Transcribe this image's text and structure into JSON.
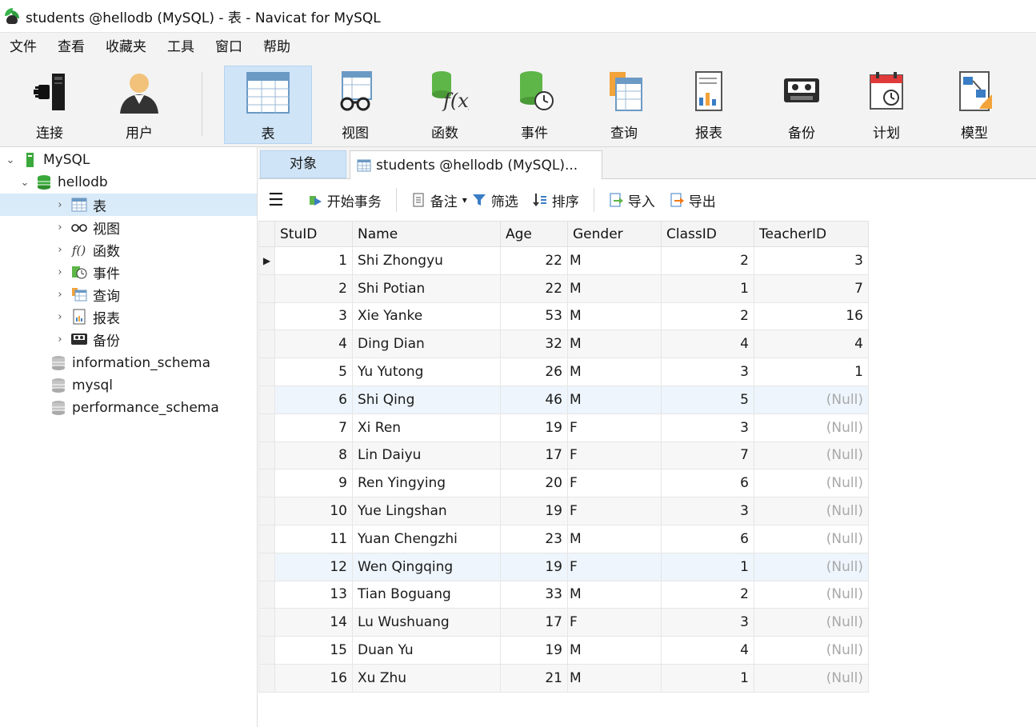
{
  "window": {
    "title": "students @hellodb (MySQL) - 表 - Navicat for MySQL"
  },
  "menu": [
    "文件",
    "查看",
    "收藏夹",
    "工具",
    "窗口",
    "帮助"
  ],
  "toolbar": {
    "connect": "连接",
    "user": "用户",
    "table": "表",
    "view": "视图",
    "function": "函数",
    "event": "事件",
    "query": "查询",
    "report": "报表",
    "backup": "备份",
    "schedule": "计划",
    "model": "模型"
  },
  "tree": {
    "server": "MySQL",
    "db": "hellodb",
    "tables": "表",
    "views": "视图",
    "functions": "函数",
    "events": "事件",
    "queries": "查询",
    "reports": "报表",
    "backups": "备份",
    "other_dbs": [
      "information_schema",
      "mysql",
      "performance_schema"
    ]
  },
  "tabs": {
    "objects": "对象",
    "doc": "students @hellodb (MySQL)..."
  },
  "objbar": {
    "begin": "开始事务",
    "note": "备注",
    "filter": "筛选",
    "sort": "排序",
    "import": "导入",
    "export": "导出"
  },
  "grid": {
    "columns": [
      "StuID",
      "Name",
      "Age",
      "Gender",
      "ClassID",
      "TeacherID"
    ],
    "rows": [
      [
        "1",
        "Shi Zhongyu",
        "22",
        "M",
        "2",
        "3"
      ],
      [
        "2",
        "Shi Potian",
        "22",
        "M",
        "1",
        "7"
      ],
      [
        "3",
        "Xie Yanke",
        "53",
        "M",
        "2",
        "16"
      ],
      [
        "4",
        "Ding Dian",
        "32",
        "M",
        "4",
        "4"
      ],
      [
        "5",
        "Yu Yutong",
        "26",
        "M",
        "3",
        "1"
      ],
      [
        "6",
        "Shi Qing",
        "46",
        "M",
        "5",
        "(Null)"
      ],
      [
        "7",
        "Xi Ren",
        "19",
        "F",
        "3",
        "(Null)"
      ],
      [
        "8",
        "Lin Daiyu",
        "17",
        "F",
        "7",
        "(Null)"
      ],
      [
        "9",
        "Ren Yingying",
        "20",
        "F",
        "6",
        "(Null)"
      ],
      [
        "10",
        "Yue Lingshan",
        "19",
        "F",
        "3",
        "(Null)"
      ],
      [
        "11",
        "Yuan Chengzhi",
        "23",
        "M",
        "6",
        "(Null)"
      ],
      [
        "12",
        "Wen Qingqing",
        "19",
        "F",
        "1",
        "(Null)"
      ],
      [
        "13",
        "Tian Boguang",
        "33",
        "M",
        "2",
        "(Null)"
      ],
      [
        "14",
        "Lu Wushuang",
        "17",
        "F",
        "3",
        "(Null)"
      ],
      [
        "15",
        "Duan Yu",
        "19",
        "M",
        "4",
        "(Null)"
      ],
      [
        "16",
        "Xu Zhu",
        "21",
        "M",
        "1",
        "(Null)"
      ]
    ]
  },
  "colors": {
    "accent": "#cfe4f7",
    "selection": "#d9eaf8",
    "null_text": "#a9a9a9",
    "db_green": "#3aa93a"
  }
}
